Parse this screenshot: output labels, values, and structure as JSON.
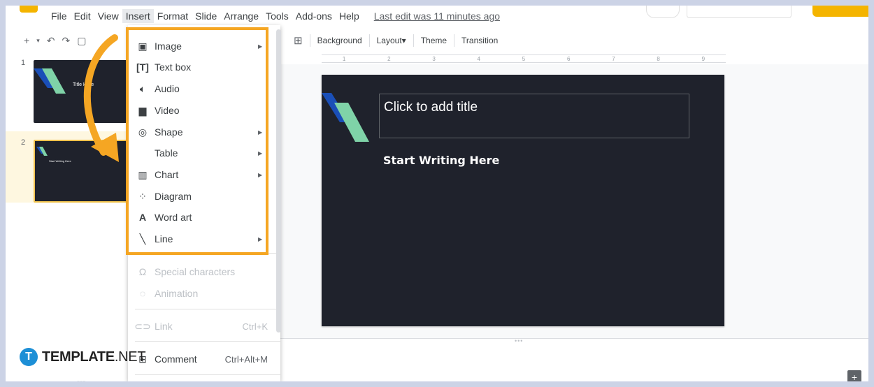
{
  "menubar": {
    "items": [
      "File",
      "Edit",
      "View",
      "Insert",
      "Format",
      "Slide",
      "Arrange",
      "Tools",
      "Add-ons",
      "Help"
    ],
    "last_edit": "Last edit was 11 minutes ago"
  },
  "toolbar": {
    "add_icon": "plus-icon",
    "background": "Background",
    "layout": "Layout▾",
    "theme": "Theme",
    "transition": "Transition"
  },
  "filmstrip": {
    "slides": [
      {
        "number": "1",
        "text": "Title Here"
      },
      {
        "number": "2",
        "text": "Start Writing Here"
      }
    ]
  },
  "slide": {
    "title_placeholder": "Click to add title",
    "subtitle": "Start Writing Here"
  },
  "ruler": {
    "ticks": [
      "1",
      "2",
      "3",
      "4",
      "5",
      "6",
      "7",
      "8",
      "9"
    ]
  },
  "insert_menu": {
    "items": [
      {
        "label": "Image",
        "icon": "image-icon",
        "submenu": true
      },
      {
        "label": "Text box",
        "icon": "text-box-icon",
        "submenu": false
      },
      {
        "label": "Audio",
        "icon": "audio-icon",
        "submenu": false
      },
      {
        "label": "Video",
        "icon": "video-icon",
        "submenu": false
      },
      {
        "label": "Shape",
        "icon": "shape-icon",
        "submenu": true
      },
      {
        "label": "Table",
        "icon": "",
        "submenu": true
      },
      {
        "label": "Chart",
        "icon": "chart-icon",
        "submenu": true
      },
      {
        "label": "Diagram",
        "icon": "diagram-icon",
        "submenu": false
      },
      {
        "label": "Word art",
        "icon": "word-art-icon",
        "submenu": false
      },
      {
        "label": "Line",
        "icon": "line-icon",
        "submenu": true
      },
      {
        "label": "Special characters",
        "icon": "omega-icon",
        "disabled": true
      },
      {
        "label": "Animation",
        "icon": "animation-icon",
        "disabled": true
      },
      {
        "label": "Link",
        "icon": "link-icon",
        "shortcut": "Ctrl+K",
        "disabled": true
      },
      {
        "label": "Comment",
        "icon": "comment-icon",
        "shortcut": "Ctrl+Alt+M"
      }
    ]
  },
  "watermark": {
    "badge": "T",
    "brand": "TEMPLATE",
    "suffix": ".NET"
  },
  "colors": {
    "highlight": "#f5a623",
    "slide_bg": "#1f222c",
    "accent_blue": "#1a4fb8",
    "accent_green": "#7fd3a8",
    "arrow": "#f5a623"
  }
}
